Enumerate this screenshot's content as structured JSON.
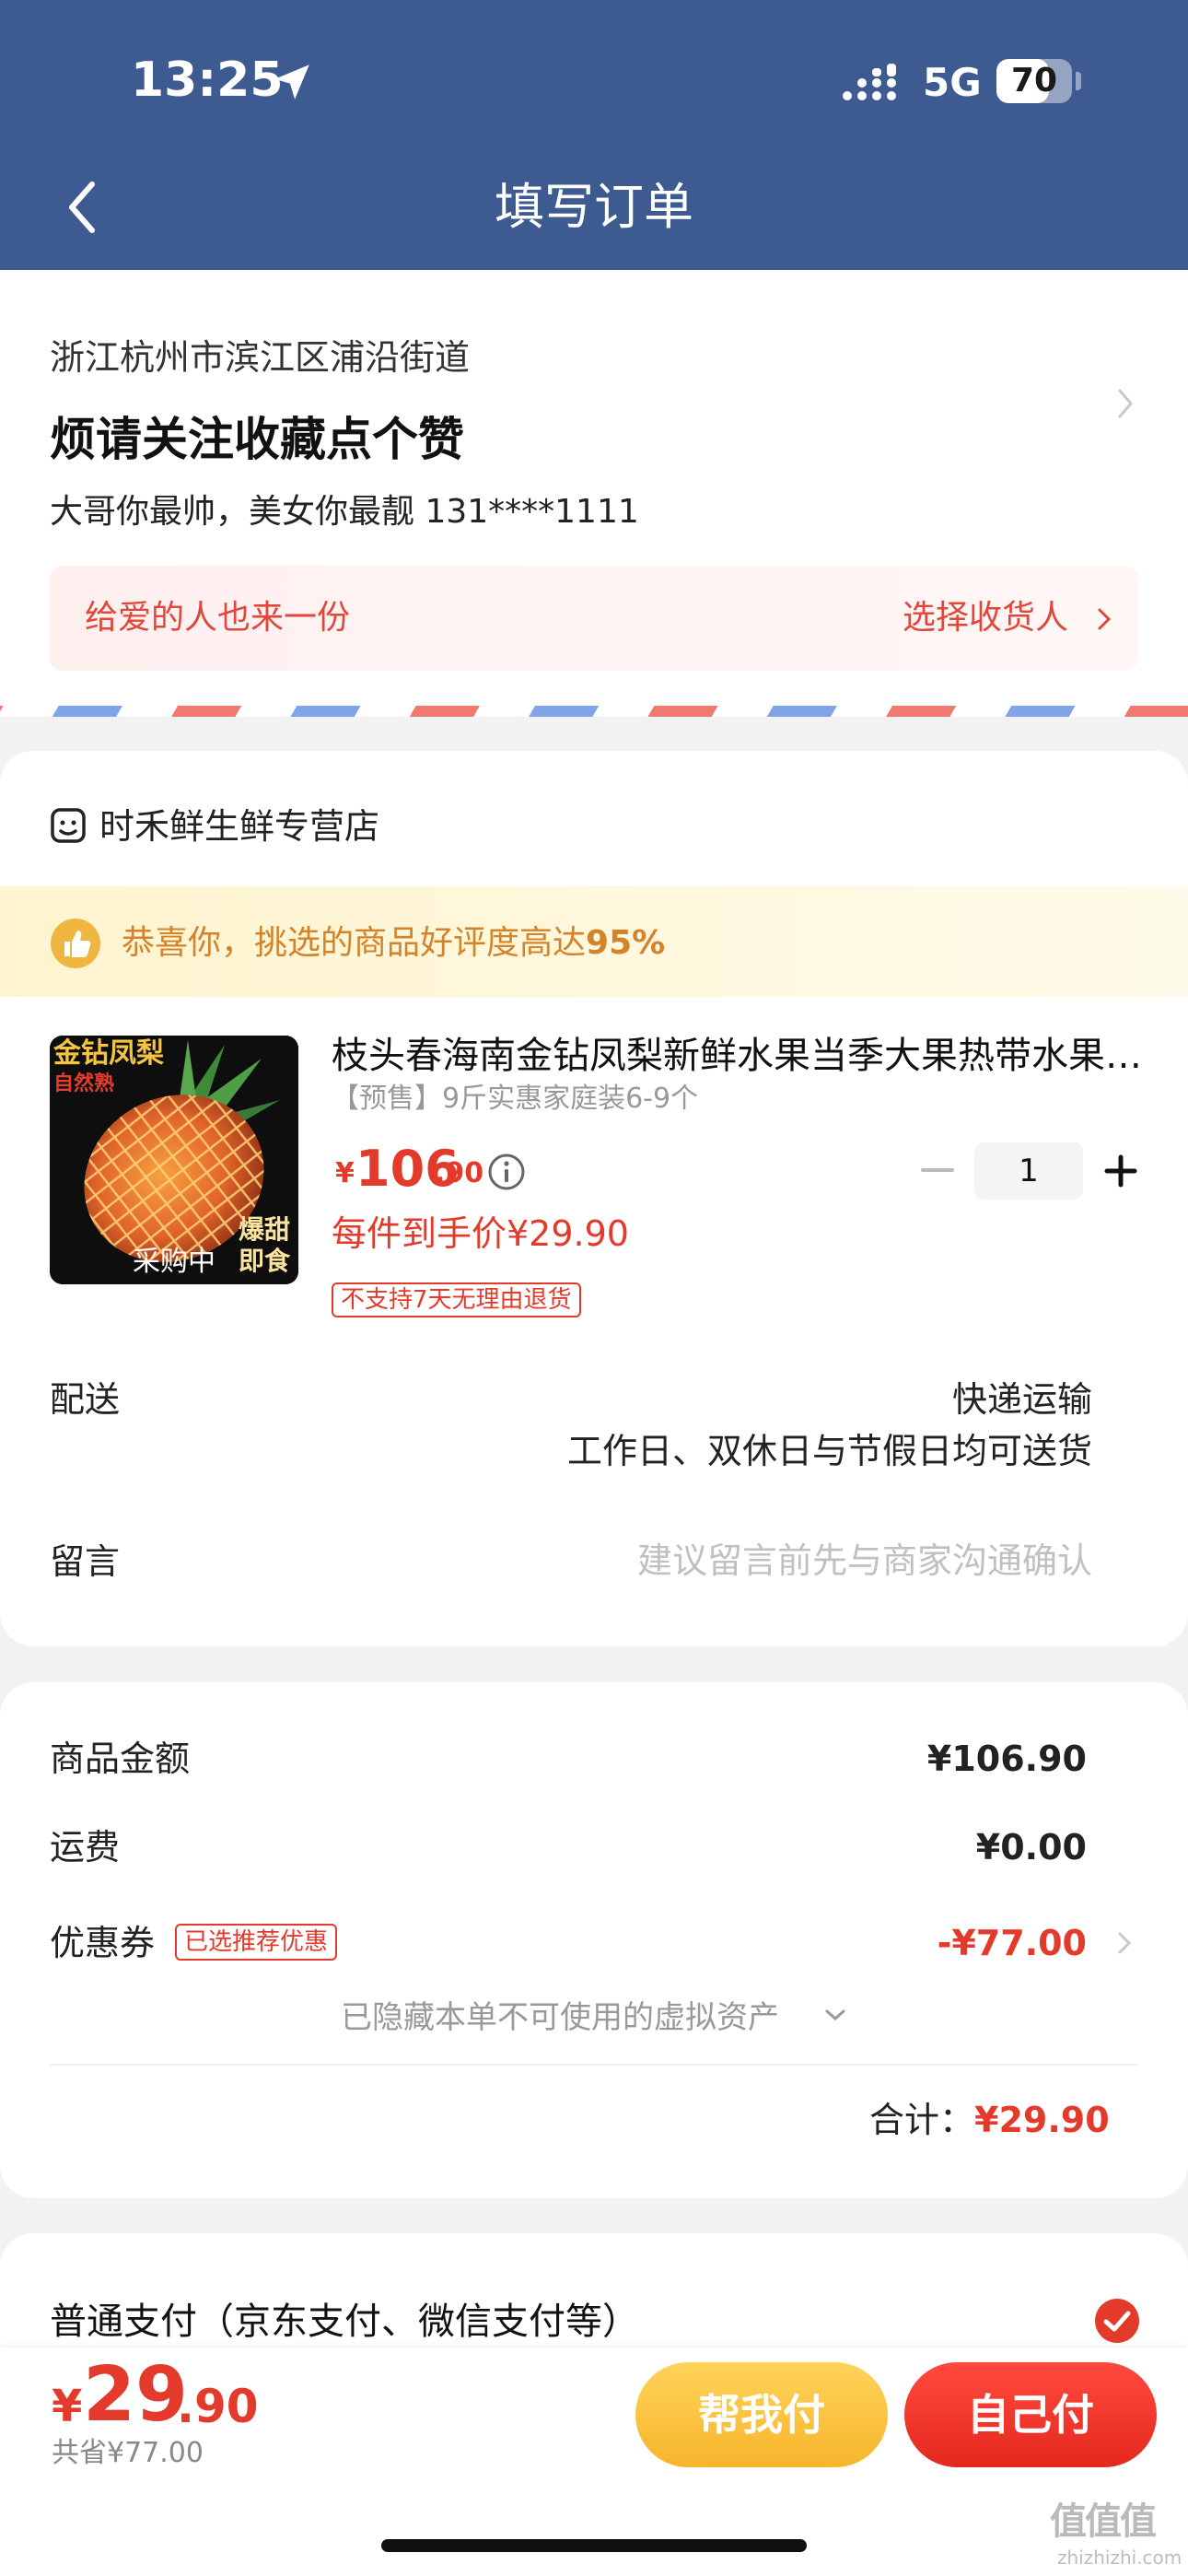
{
  "status_bar": {
    "time": "13:25",
    "network": "5G",
    "battery_text": "70",
    "battery_level": 0.7
  },
  "nav": {
    "title": "填写订单",
    "back_icon": "chevron-left-icon"
  },
  "address": {
    "region": "浙江杭州市滨江区浦沿街道",
    "detail": "烦请关注收藏点个赞",
    "contact": "大哥你最帅，美女你最靓  131****1111",
    "gift_text": "给爱的人也来一份",
    "gift_action": "选择收货人"
  },
  "store": {
    "name": "时禾鲜生鲜专营店",
    "promo": "恭喜你，挑选的商品好评度高达",
    "promo_value": "95%"
  },
  "product": {
    "image_tag_gold": "金钻凤梨",
    "image_tag_red": "自然熟",
    "image_badge": "爆甜即食",
    "image_status": "采购中",
    "title": "枝头春海南金钻凤梨新鲜水果当季大果热带水果…",
    "spec": "【预售】9斤实惠家庭装6-9个",
    "price_yen": "¥",
    "price_int": "106",
    "price_dec": ".90",
    "quantity": "1",
    "unit_price": "每件到手价¥29.90",
    "return_tag": "不支持7天无理由退货"
  },
  "delivery": {
    "label": "配送",
    "value": "快递运输",
    "note": "工作日、双休日与节假日均可送货"
  },
  "message": {
    "label": "留言",
    "placeholder": "建议留言前先与商家沟通确认"
  },
  "summary": {
    "goods_label": "商品金额",
    "goods_value": "¥106.90",
    "shipping_label": "运费",
    "shipping_value": "¥0.00",
    "coupon_label": "优惠券",
    "coupon_tag": "已选推荐优惠",
    "coupon_value": "-¥77.00",
    "hidden_note": "已隐藏本单不可使用的虚拟资产",
    "total_label": "合计：",
    "total_value": "¥29.90"
  },
  "payment": {
    "method": "普通支付（京东支付、微信支付等）"
  },
  "bottom": {
    "yen": "¥",
    "pay_int": "29",
    "pay_dec": ".90",
    "total_note": "共省¥77.00",
    "help_pay": "帮我付",
    "self_pay": "自己付"
  },
  "colors": {
    "header_bg": "#3d5a91",
    "accent_red": "#e33a2c",
    "promo_orange": "#d4832a",
    "help_yellow": "#f7b52b"
  },
  "watermark": {
    "text": "值值值",
    "sub": "zhizhizhi.com"
  }
}
